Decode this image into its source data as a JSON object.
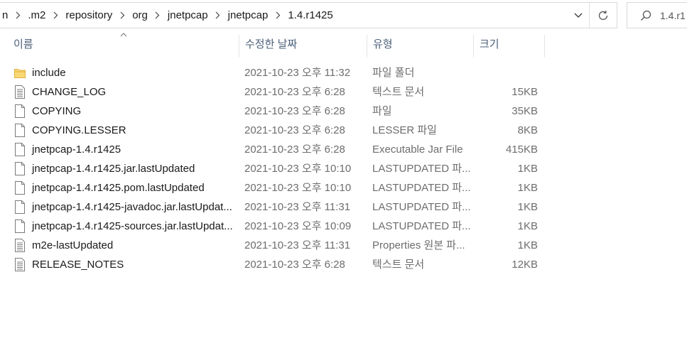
{
  "address": {
    "crumbs": [
      "n",
      ".m2",
      "repository",
      "org",
      "jnetpcap",
      "jnetpcap",
      "1.4.r1425"
    ]
  },
  "search": {
    "text": "1.4.r1"
  },
  "columns": {
    "name": "이름",
    "date": "수정한 날짜",
    "type": "유형",
    "size": "크기"
  },
  "files": [
    {
      "name": "include",
      "date": "2021-10-23 오후 11:32",
      "type": "파일 폴더",
      "size": "",
      "icon": "folder-icon"
    },
    {
      "name": "CHANGE_LOG",
      "date": "2021-10-23 오후 6:28",
      "type": "텍스트 문서",
      "size": "15KB",
      "icon": "text-file-icon"
    },
    {
      "name": "COPYING",
      "date": "2021-10-23 오후 6:28",
      "type": "파일",
      "size": "35KB",
      "icon": "file-icon"
    },
    {
      "name": "COPYING.LESSER",
      "date": "2021-10-23 오후 6:28",
      "type": "LESSER 파일",
      "size": "8KB",
      "icon": "file-icon"
    },
    {
      "name": "jnetpcap-1.4.r1425",
      "date": "2021-10-23 오후 6:28",
      "type": "Executable Jar File",
      "size": "415KB",
      "icon": "file-icon"
    },
    {
      "name": "jnetpcap-1.4.r1425.jar.lastUpdated",
      "date": "2021-10-23 오후 10:10",
      "type": "LASTUPDATED 파...",
      "size": "1KB",
      "icon": "file-icon"
    },
    {
      "name": "jnetpcap-1.4.r1425.pom.lastUpdated",
      "date": "2021-10-23 오후 10:10",
      "type": "LASTUPDATED 파...",
      "size": "1KB",
      "icon": "file-icon"
    },
    {
      "name": "jnetpcap-1.4.r1425-javadoc.jar.lastUpdat...",
      "date": "2021-10-23 오후 11:31",
      "type": "LASTUPDATED 파...",
      "size": "1KB",
      "icon": "file-icon"
    },
    {
      "name": "jnetpcap-1.4.r1425-sources.jar.lastUpdat...",
      "date": "2021-10-23 오후 10:09",
      "type": "LASTUPDATED 파...",
      "size": "1KB",
      "icon": "file-icon"
    },
    {
      "name": "m2e-lastUpdated",
      "date": "2021-10-23 오후 11:31",
      "type": "Properties 원본 파...",
      "size": "1KB",
      "icon": "text-file-icon"
    },
    {
      "name": "RELEASE_NOTES",
      "date": "2021-10-23 오후 6:28",
      "type": "텍스트 문서",
      "size": "12KB",
      "icon": "text-file-icon"
    }
  ]
}
